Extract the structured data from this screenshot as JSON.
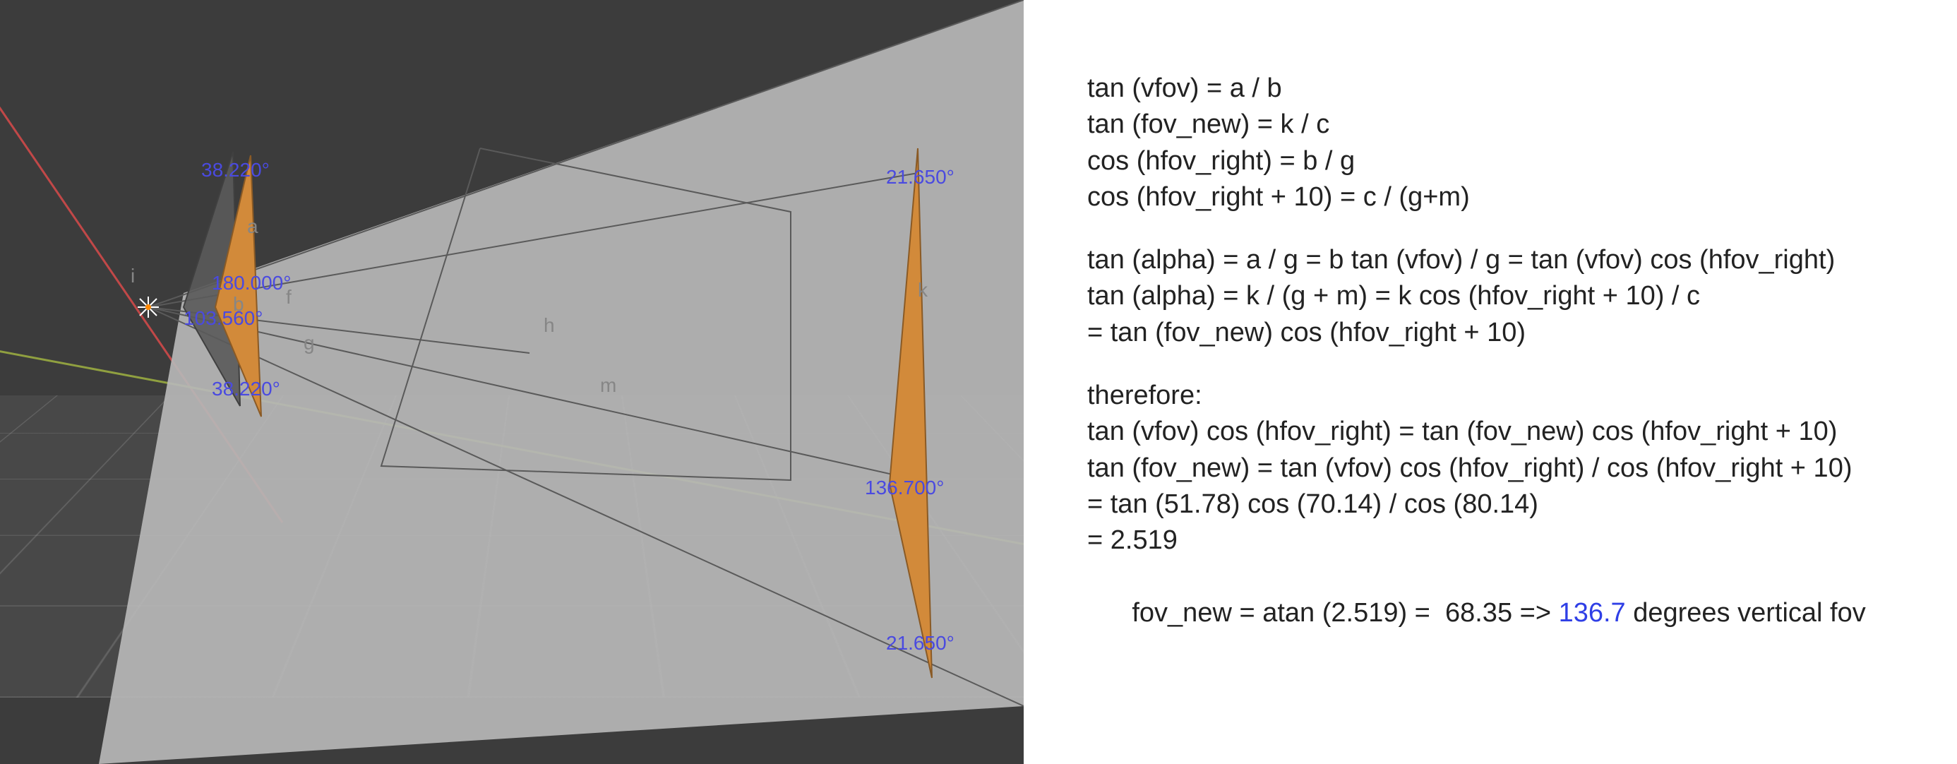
{
  "viewport": {
    "angles": {
      "top_left_small": "38.220°",
      "mid_left_180": "180.000°",
      "mid_left_sum": "103.560°",
      "bottom_left_small": "38.220°",
      "top_right_small": "21.650°",
      "mid_right_big": "136.700°",
      "bottom_right_small": "21.650°"
    },
    "edge_labels": {
      "a": "a",
      "b": "b",
      "f": "f",
      "g": "g",
      "h": "h",
      "m": "m",
      "k": "k",
      "i": "i"
    },
    "colors": {
      "frustum_fill": "#b7b7b7",
      "frustum_stroke": "#4a4a4a",
      "tri_fill": "#d28a3a",
      "tri_stroke": "#8a5a25",
      "label_blue": "#4a4ae0",
      "axis_x": "#c14848",
      "axis_y": "#90a040",
      "axis_origin": "#ffffff"
    }
  },
  "math": {
    "eq1": "tan (vfov) = a / b",
    "eq2": "tan (fov_new) = k / c",
    "eq3": "cos (hfov_right) = b / g",
    "eq4": "cos (hfov_right + 10) = c / (g+m)",
    "eq5": "tan (alpha) = a / g = b tan (vfov) / g = tan (vfov) cos (hfov_right)",
    "eq6": "tan (alpha) = k / (g + m) = k cos (hfov_right + 10) / c",
    "eq7": "= tan (fov_new) cos (hfov_right + 10)",
    "therefore": "therefore:",
    "eq8": "tan (vfov) cos (hfov_right) = tan (fov_new) cos (hfov_right + 10)",
    "eq9": "tan (fov_new) = tan (vfov) cos (hfov_right) / cos (hfov_right + 10)",
    "eq10": "= tan (51.78) cos (70.14) / cos (80.14)",
    "eq11": "= 2.519",
    "eq12_pre": "fov_new = atan (2.519) =  68.35 => ",
    "eq12_blue": "136.7",
    "eq12_post": " degrees vertical fov"
  }
}
